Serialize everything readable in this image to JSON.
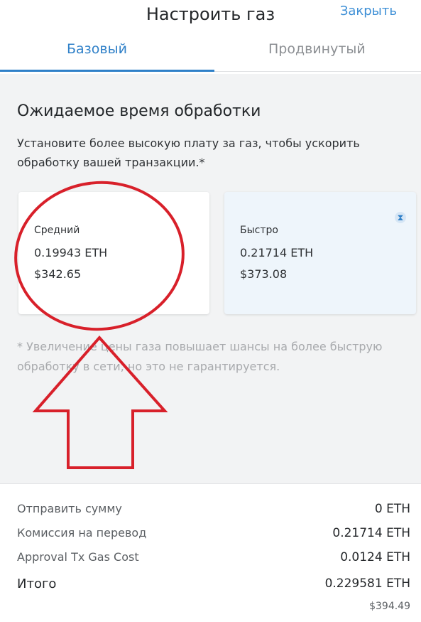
{
  "header": {
    "title": "Настроить газ",
    "close_label": "Закрыть",
    "tabs": [
      {
        "label": "Базовый",
        "active": true
      },
      {
        "label": "Продвинутый",
        "active": false
      }
    ]
  },
  "main": {
    "section_title": "Ожидаемое время обработки",
    "description": "Установите более высокую плату за газ, чтобы ускорить обработку вашей транзакции.*",
    "options": [
      {
        "label": "Средний",
        "eth": "0.19943 ETH",
        "usd": "$342.65"
      },
      {
        "label": "Быстро",
        "eth": "0.21714 ETH",
        "usd": "$373.08",
        "icon": "hourglass-icon"
      }
    ],
    "note": "* Увеличение цены газа повышает шансы на более быструю обработку в сети, но это не гарантируется."
  },
  "summary": {
    "rows": [
      {
        "label": "Отправить сумму",
        "value": "0 ETH"
      },
      {
        "label": "Комиссия на перевод",
        "value": "0.21714 ETH"
      },
      {
        "label": "Approval Tx Gas Cost",
        "value": "0.0124 ETH"
      },
      {
        "label": "Итого",
        "value": "0.229581 ETH"
      }
    ],
    "total_usd": "$394.49"
  },
  "colors": {
    "accent": "#2f80c8",
    "annotation": "#d8202a"
  }
}
